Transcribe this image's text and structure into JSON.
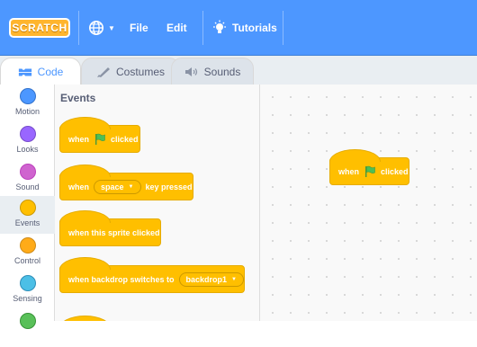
{
  "menubar": {
    "logo": "SCRATCH",
    "file": "File",
    "edit": "Edit",
    "tutorials": "Tutorials"
  },
  "tabs": {
    "code": "Code",
    "costumes": "Costumes",
    "sounds": "Sounds"
  },
  "categories": [
    {
      "label": "Motion",
      "color": "#4c97ff"
    },
    {
      "label": "Looks",
      "color": "#9966ff"
    },
    {
      "label": "Sound",
      "color": "#cf63cf"
    },
    {
      "label": "Events",
      "color": "#ffbf00"
    },
    {
      "label": "Control",
      "color": "#ffab19"
    },
    {
      "label": "Sensing",
      "color": "#4cbfe6"
    }
  ],
  "palette": {
    "title": "Events",
    "blocks": {
      "flag_when": "when",
      "flag_clicked": "clicked",
      "key_when": "when",
      "key_value": "space",
      "key_pressed": "key pressed",
      "sprite_clicked": "when this sprite clicked",
      "backdrop_text": "when backdrop switches to",
      "backdrop_value": "backdrop1"
    }
  },
  "workspace": {
    "flag_when": "when",
    "flag_clicked": "clicked"
  },
  "colors": {
    "menubar": "#4d97ff",
    "events": "#ffbf00",
    "flag": "#4cbf56"
  }
}
